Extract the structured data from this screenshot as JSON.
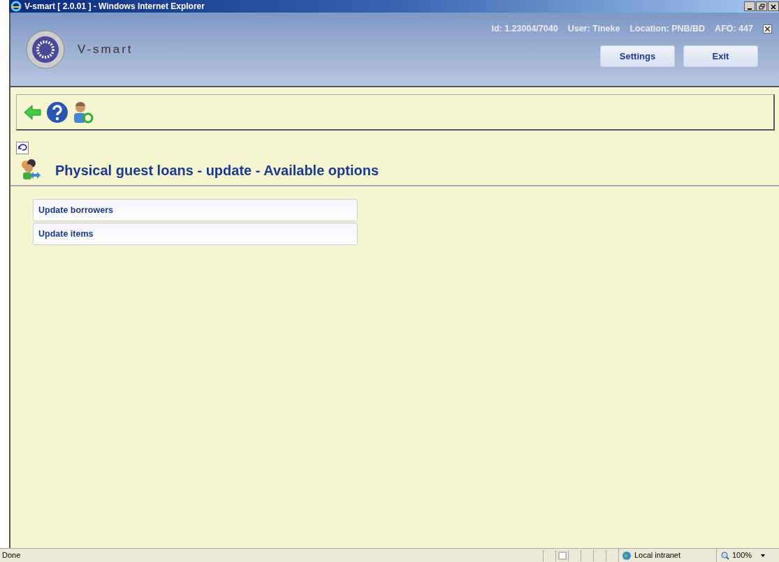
{
  "window": {
    "title": "V-smart [ 2.0.01 ] - Windows Internet Explorer"
  },
  "header": {
    "logo_text": "V-smart",
    "info": [
      "Id: 1.23004/7040",
      "User: Tineke",
      "Location: PNB/BD",
      "AFO: 447"
    ],
    "buttons": [
      "Settings",
      "Exit"
    ]
  },
  "page": {
    "title": "Physical guest loans - update - Available options",
    "options": [
      "Update borrowers",
      "Update items"
    ]
  },
  "status_bar": {
    "text": "Done",
    "zone": "Local intranet",
    "zoom": "100%"
  }
}
